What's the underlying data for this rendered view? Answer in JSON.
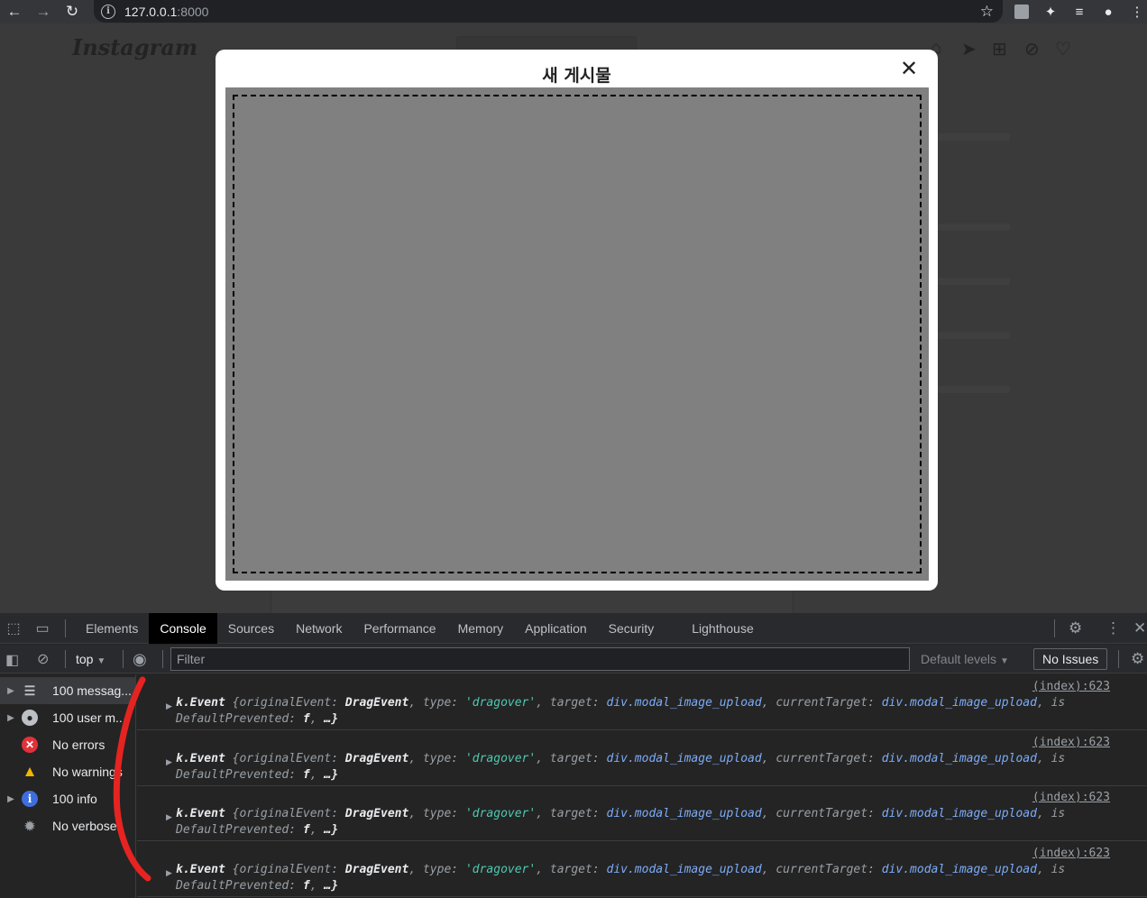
{
  "browser": {
    "url_host": "127.0.0.1",
    "url_port": ":8000"
  },
  "modal": {
    "title": "새 게시물",
    "close_label": "✕"
  },
  "devtools": {
    "tabs": [
      {
        "label": "Elements"
      },
      {
        "label": "Console"
      },
      {
        "label": "Sources"
      },
      {
        "label": "Network"
      },
      {
        "label": "Performance"
      },
      {
        "label": "Memory"
      },
      {
        "label": "Application"
      },
      {
        "label": "Security"
      },
      {
        "label": "Lighthouse"
      }
    ],
    "toolbar": {
      "context": "top",
      "filter_placeholder": "Filter",
      "levels": "Default levels",
      "issues": "No Issues"
    },
    "sidebar": [
      {
        "label": "100 messag...",
        "icon": "list-icon"
      },
      {
        "label": "100 user m...",
        "icon": "user-icon"
      },
      {
        "label": "No errors",
        "icon": "error-icon"
      },
      {
        "label": "No warnings",
        "icon": "warning-icon"
      },
      {
        "label": "100 info",
        "icon": "info-icon"
      },
      {
        "label": "No verbose",
        "icon": "bug-icon"
      }
    ],
    "log": {
      "source": "(index):623",
      "class_name": "k.Event",
      "k1": "originalEvent",
      "v1": "DragEvent",
      "k2": "type",
      "v2": "'dragover'",
      "k3": "target",
      "v3": "div.modal_image_upload",
      "k4": "currentTarget",
      "v4": "div.modal_image_upload",
      "trail": "is",
      "line2_key": "DefaultPrevented",
      "line2_val": "f",
      "ellipsis": "…"
    }
  }
}
